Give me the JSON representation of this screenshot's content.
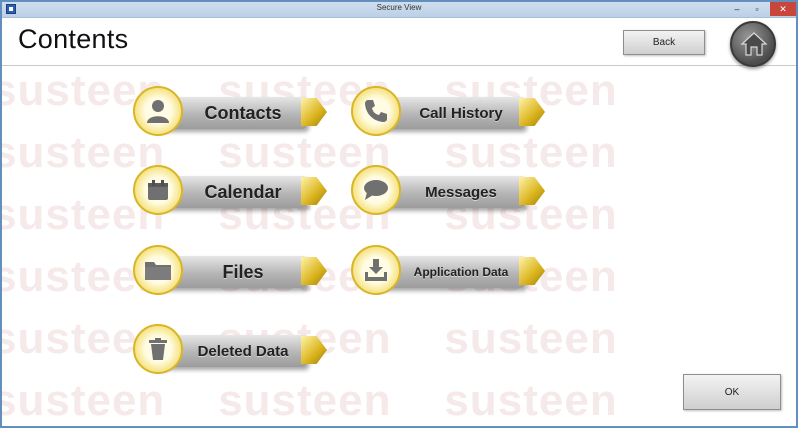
{
  "window": {
    "title": "Secure View",
    "min_glyph": "–",
    "max_glyph": "▫",
    "close_glyph": "✕"
  },
  "header": {
    "title": "Contents",
    "back_label": "Back",
    "home_icon": "home-icon"
  },
  "watermark": {
    "text": "susteen"
  },
  "menu": {
    "contacts": {
      "label": "Contacts",
      "icon": "person-icon"
    },
    "call_history": {
      "label": "Call History",
      "icon": "phone-icon"
    },
    "calendar": {
      "label": "Calendar",
      "icon": "calendar-icon"
    },
    "messages": {
      "label": "Messages",
      "icon": "speech-bubble-icon"
    },
    "files": {
      "label": "Files",
      "icon": "folder-icon"
    },
    "application_data": {
      "label": "Application Data",
      "icon": "download-tray-icon"
    },
    "deleted_data": {
      "label": "Deleted Data",
      "icon": "trash-icon"
    }
  },
  "footer": {
    "ok_label": "OK"
  },
  "colors": {
    "accent_gold": "#d9b528",
    "button_grey": "#b5b5b5",
    "watermark_pink": "#f6e9e9",
    "titlebar_blue": "#cfdfee"
  }
}
